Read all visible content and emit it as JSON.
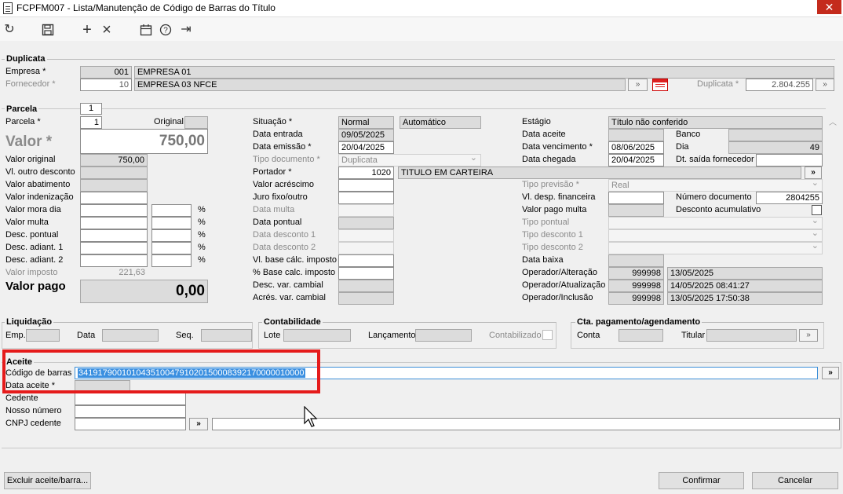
{
  "window": {
    "title": "FCPFM007 - Lista/Manutenção de Código de Barras do Título"
  },
  "toolbar": {
    "refresh": "↻",
    "save": "💾",
    "add": "+",
    "close_x": "×",
    "calendar": "▦",
    "help": "?",
    "exit": "⇥"
  },
  "duplicata": {
    "title": "Duplicata",
    "empresa_label": "Empresa *",
    "empresa_code": "001",
    "empresa_name": "EMPRESA 01",
    "fornecedor_label": "Fornecedor *",
    "fornecedor_code": "10",
    "fornecedor_name": "EMPRESA 03 NFCE",
    "duplicata_label": "Duplicata *",
    "duplicata_value": "2.804.255",
    "browse": "»"
  },
  "parcela": {
    "title": "Parcela",
    "tab": "1",
    "parcela_label": "Parcela *",
    "parcela_value": "1",
    "original_label": "Original",
    "valor_label": "Valor *",
    "valor_value": "750,00",
    "valor_original_label": "Valor original",
    "valor_original": "750,00",
    "vl_outro_desconto": "Vl. outro desconto",
    "valor_abatimento": "Valor abatimento",
    "valor_indenizacao": "Valor indenização",
    "valor_mora_dia": "Valor mora dia",
    "valor_multa": "Valor multa",
    "desc_pontual": "Desc. pontual",
    "desc_adiant_1": "Desc. adiant. 1",
    "desc_adiant_2": "Desc. adiant. 2",
    "percent": "%",
    "valor_imposto_label": "Valor imposto",
    "valor_imposto": "221,63",
    "valor_pago_label": "Valor pago",
    "valor_pago": "0,00"
  },
  "mid": {
    "situacao_label": "Situação *",
    "situacao": "Normal",
    "automatico": "Automático",
    "data_entrada_label": "Data entrada",
    "data_entrada": "09/05/2025",
    "data_emissao_label": "Data emissão *",
    "data_emissao": "20/04/2025",
    "tipo_documento_label": "Tipo documento *",
    "tipo_documento": "Duplicata",
    "portador_label": "Portador *",
    "portador_code": "1020",
    "portador_name": "TITULO EM CARTEIRA",
    "valor_acrescimo": "Valor acréscimo",
    "juro_fixo": "Juro fixo/outro",
    "data_multa": "Data multa",
    "data_pontual": "Data pontual",
    "data_desconto_1": "Data desconto 1",
    "data_desconto_2": "Data desconto 2",
    "vl_base_calc": "Vl. base cálc. imposto",
    "pct_base_calc": "% Base calc. imposto",
    "desc_var_cambial": "Desc. var. cambial",
    "acres_var_cambial": "Acrés. var. cambial"
  },
  "right": {
    "estagio_label": "Estágio",
    "estagio": "Título não conferido",
    "data_aceite": "Data aceite",
    "banco": "Banco",
    "data_vencimento_label": "Data vencimento *",
    "data_vencimento": "08/06/2025",
    "dia_label": "Dia",
    "dia": "49",
    "data_chegada_label": "Data chegada",
    "data_chegada": "20/04/2025",
    "dt_saida": "Dt. saída fornecedor",
    "tipo_previsao_label": "Tipo previsão *",
    "tipo_previsao": "Real",
    "vl_desp_fin": "Vl. desp. financeira",
    "numero_doc_label": "Número documento",
    "numero_doc": "2804255",
    "valor_pago_multa": "Valor pago multa",
    "desconto_acumulativo": "Desconto acumulativo",
    "tipo_pontual": "Tipo pontual",
    "tipo_desconto_1": "Tipo desconto 1",
    "tipo_desconto_2": "Tipo desconto 2",
    "data_baixa": "Data baixa",
    "op_alteracao_label": "Operador/Alteração",
    "op_alteracao_code": "999998",
    "op_alteracao_date": "13/05/2025",
    "op_atualizacao_label": "Operador/Atualização",
    "op_atualizacao_code": "999998",
    "op_atualizacao_date": "14/05/2025 08:41:27",
    "op_inclusao_label": "Operador/Inclusão",
    "op_inclusao_code": "999998",
    "op_inclusao_date": "13/05/2025 17:50:38"
  },
  "liquidacao": {
    "title": "Liquidação",
    "emp": "Emp.",
    "data": "Data",
    "seq": "Seq."
  },
  "contabilidade": {
    "title": "Contabilidade",
    "lote": "Lote",
    "lancamento": "Lançamento",
    "contabilizado": "Contabilizado"
  },
  "cta": {
    "title": "Cta. pagamento/agendamento",
    "conta": "Conta",
    "titular": "Titular"
  },
  "aceite": {
    "title": "Aceite",
    "codigo_barras_label": "Código de barras",
    "codigo_barras": "34191790010104351004791020150008392170000010000",
    "data_aceite_label": "Data aceite *",
    "cedente": "Cedente",
    "nosso_numero": "Nosso número",
    "cnpj_cedente": "CNPJ cedente",
    "browse": "»"
  },
  "footer": {
    "excluir": "Excluir aceite/barra...",
    "confirmar": "Confirmar",
    "cancelar": "Cancelar"
  }
}
